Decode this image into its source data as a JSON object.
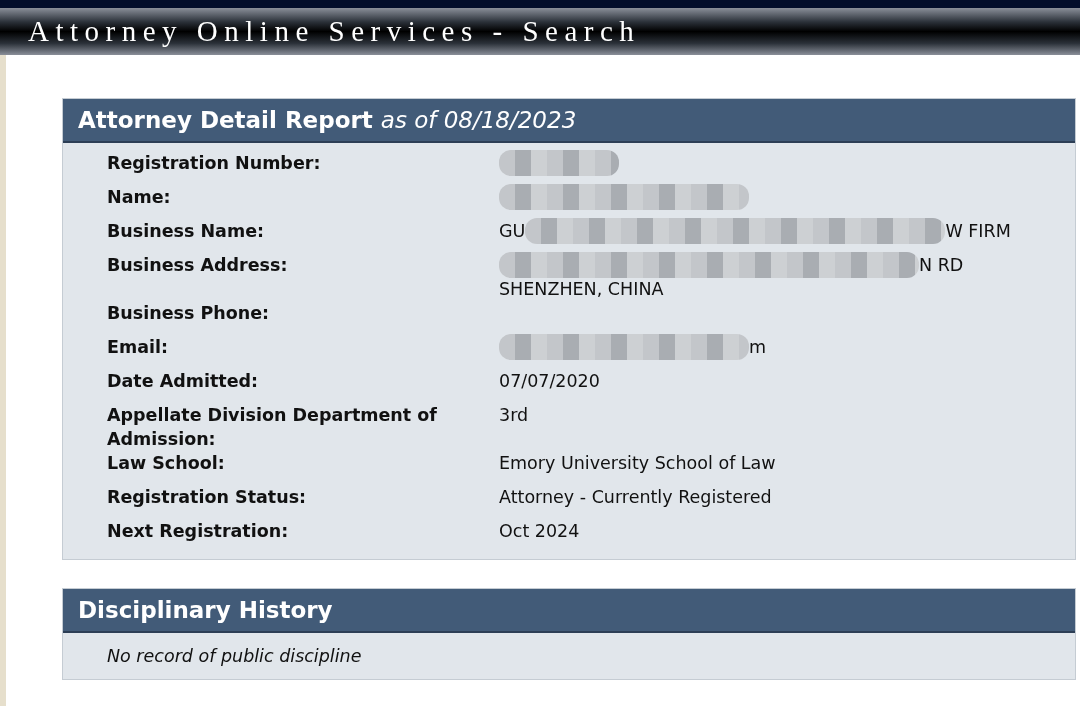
{
  "site_title": "Attorney Online Services - Search",
  "detail_report": {
    "title": "Attorney Detail Report",
    "as_of": "as of 08/18/2023",
    "rows": [
      {
        "label": "Registration Number:",
        "lines": [
          [
            {
              "kind": "blur-short"
            }
          ]
        ]
      },
      {
        "label": "Name:",
        "lines": [
          [
            {
              "kind": "blur-medium"
            }
          ]
        ]
      },
      {
        "label": "Business Name:",
        "lines": [
          [
            {
              "kind": "text",
              "text": "GU"
            },
            {
              "kind": "blur-long"
            },
            {
              "kind": "text",
              "text": "W FIRM"
            }
          ]
        ]
      },
      {
        "label": "Business Address:",
        "lines": [
          [
            {
              "kind": "blur-long"
            },
            {
              "kind": "text",
              "text": "N RD"
            }
          ],
          [
            {
              "kind": "text",
              "text": "SHENZHEN, CHINA"
            }
          ]
        ]
      },
      {
        "label": "Business Phone:",
        "lines": []
      },
      {
        "label": "Email:",
        "lines": [
          [
            {
              "kind": "blur-medium"
            },
            {
              "kind": "text",
              "text": "m"
            }
          ]
        ]
      },
      {
        "label": "Date Admitted:",
        "lines": [
          [
            {
              "kind": "text",
              "text": "07/07/2020"
            }
          ]
        ]
      },
      {
        "label": "Appellate Division Department of Admission:",
        "lines": [
          [
            {
              "kind": "text",
              "text": "3rd"
            }
          ]
        ]
      },
      {
        "label": "Law School:",
        "lines": [
          [
            {
              "kind": "text",
              "text": "Emory University School of Law"
            }
          ]
        ]
      },
      {
        "label": "Registration Status:",
        "lines": [
          [
            {
              "kind": "text",
              "text": "Attorney - Currently Registered"
            }
          ]
        ]
      },
      {
        "label": "Next Registration:",
        "lines": [
          [
            {
              "kind": "text",
              "text": "Oct 2024"
            }
          ]
        ]
      }
    ]
  },
  "disciplinary_history": {
    "title": "Disciplinary History",
    "message": "No record of public discipline"
  }
}
